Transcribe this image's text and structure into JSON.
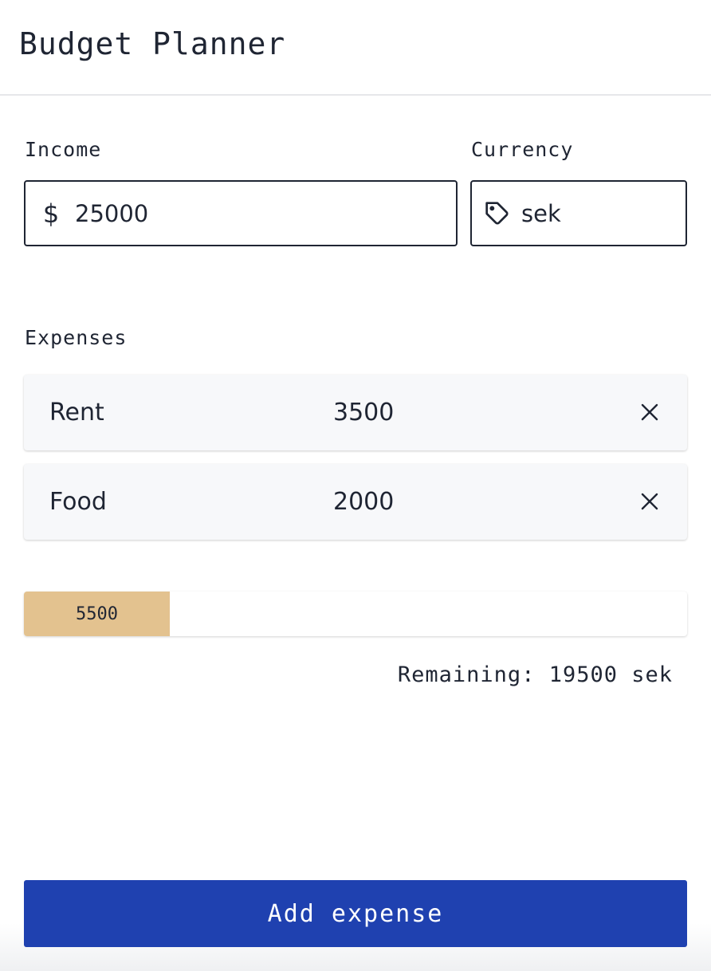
{
  "header": {
    "title": "Budget Planner"
  },
  "income": {
    "label": "Income",
    "icon": "dollar-icon",
    "icon_glyph": "$",
    "value": "25000"
  },
  "currency": {
    "label": "Currency",
    "icon": "tag-icon",
    "value": "sek"
  },
  "expenses": {
    "label": "Expenses",
    "items": [
      {
        "name": "Rent",
        "amount": "3500",
        "remove_icon": "close-icon"
      },
      {
        "name": "Food",
        "amount": "2000",
        "remove_icon": "close-icon"
      }
    ]
  },
  "progress": {
    "label": "5500",
    "spent": 5500,
    "total": 25000,
    "fill_color": "#e3c28f"
  },
  "summary": {
    "remaining_text": "Remaining: 19500 sek"
  },
  "actions": {
    "add_label": "Add expense",
    "button_color": "#1f41b0"
  }
}
